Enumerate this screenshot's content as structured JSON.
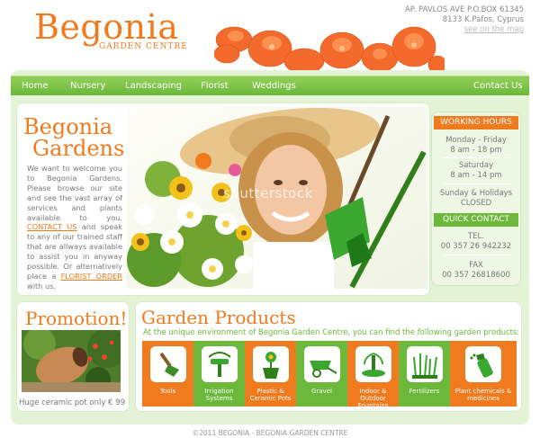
{
  "brand": {
    "name": "Begonia",
    "tagline": "GARDEN CENTRE"
  },
  "address": {
    "line1": "AP. PAVLOS AVE P.O.BOX 61345",
    "line2": "8133 K.Pafos, Cyprus",
    "map_link": "see on the map"
  },
  "nav": [
    "Home",
    "Nursery",
    "Landscaping",
    "Florist",
    "Weddings",
    "Contact Us"
  ],
  "welcome": {
    "title_line1": "Begonia",
    "title_line2": "Gardens",
    "text_before": "We want to welcome you to Begonia Gardens. Please browse our site and see the vast array of services and plants available to you. ",
    "link1": "CONTACT US",
    "text_middle": " and speak to any of our trained staff that are allways available to assist you in anyway possible. Or alternatively place a ",
    "link2": "FLORIST ORDER",
    "text_after": " with us."
  },
  "hero": {
    "watermark": "shutterstock"
  },
  "working_hours": {
    "heading": "WORKING HOURS",
    "lines": [
      "Monday - Friday",
      "8 am - 18 pm",
      "Saturday",
      "8 am - 14 pm",
      "Sunday & Holidays",
      "CLOSED"
    ]
  },
  "quick_contact": {
    "heading": "QUICK CONTACT",
    "lines": [
      "TEL.",
      "00 357 26 942232",
      "FAX",
      "00 357 26818600"
    ]
  },
  "promotion": {
    "title": "Promotion!",
    "caption": "Huge ceramic pot only € 99"
  },
  "products": {
    "title": "Garden Products",
    "subtitle": "At the unique environment of Begonia Garden Centre, you can find the following garden products:",
    "items": [
      {
        "label": "Tools",
        "icon": "trowel-icon",
        "color": "#f07a1e"
      },
      {
        "label": "Irrigation Systems",
        "icon": "sprinkler-icon",
        "color": "#6bb83a"
      },
      {
        "label": "Plastic & Ceramic Pots",
        "icon": "flower-pot-icon",
        "color": "#f07a1e"
      },
      {
        "label": "Gravel",
        "icon": "wheelbarrow-icon",
        "color": "#6bb83a"
      },
      {
        "label": "Indoor & Outdoor Fountains",
        "icon": "fountain-icon",
        "color": "#f07a1e"
      },
      {
        "label": "Fertilizers",
        "icon": "grass-icon",
        "color": "#6bb83a"
      },
      {
        "label": "Plant chemicals & medicines",
        "icon": "spray-icon",
        "color": "#f07a1e"
      }
    ]
  },
  "footer": "©2011 BEGONIA - BEGONIA GARDEN CENTRE",
  "colors": {
    "orange": "#f07a1e",
    "green": "#6bb83a",
    "light_green": "#e4f3d6"
  }
}
